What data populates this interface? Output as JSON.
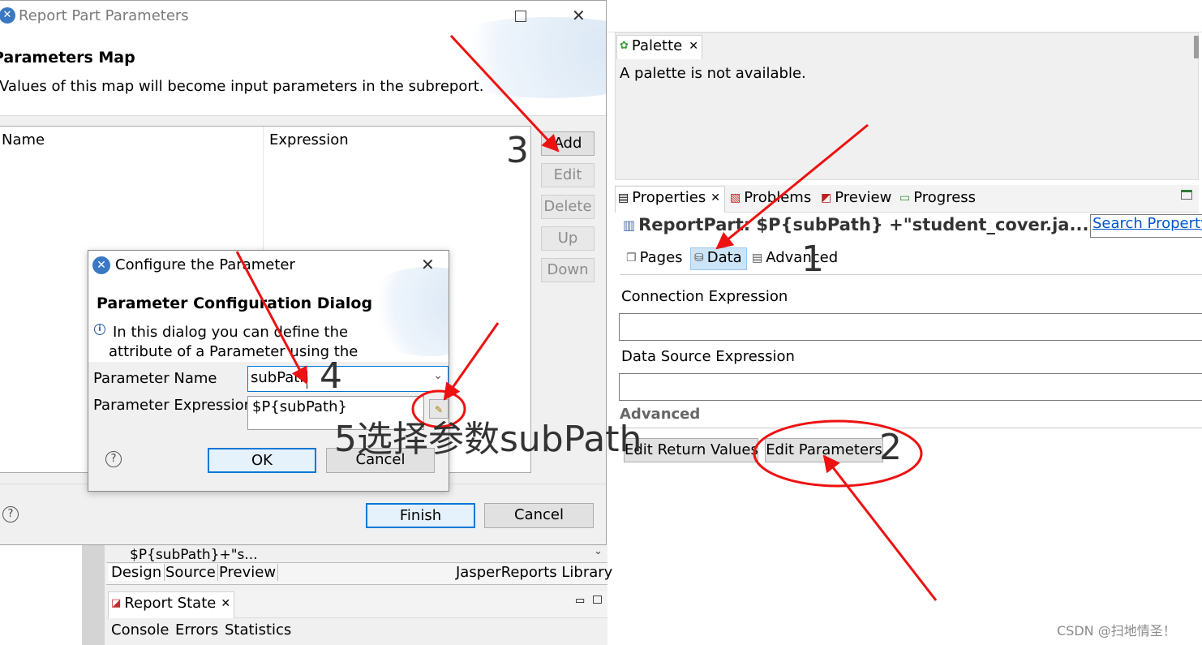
{
  "colors": {
    "accent": "#0078d7",
    "annotation": "#ee1111",
    "panel_gray": "#f0f0f0",
    "sidebar_gray": "#d4d4d4"
  },
  "main_dialog": {
    "title": "Report Part Parameters",
    "heading": "Parameters Map",
    "description": "Values of this map will become input parameters in the subreport.",
    "columns": [
      "Name",
      "Expression"
    ],
    "buttons": {
      "add": "Add",
      "edit": "Edit",
      "delete": "Delete",
      "up": "Up",
      "down": "Down",
      "finish": "Finish",
      "cancel": "Cancel"
    },
    "help_icon": "?"
  },
  "param_dialog": {
    "title": "Configure the Parameter",
    "heading": "Parameter Configuration Dialog",
    "info_line1": "In this dialog you can define the",
    "info_line2": "attribute of a Parameter using the",
    "name_label": "Parameter Name",
    "name_value": "subPath",
    "expression_label": "Parameter Expression",
    "expression_value": "$P{subPath}",
    "ok": "OK",
    "cancel": "Cancel",
    "help_icon": "?"
  },
  "bottom_editor": {
    "expression_snippet": "$P{subPath}+\"s...",
    "tabs": [
      "Design",
      "Source",
      "Preview"
    ],
    "library_label": "JasperReports Library",
    "report_state_tab": "Report State",
    "console_tabs": [
      "Console",
      "Errors",
      "Statistics"
    ]
  },
  "palette": {
    "tab_label": "Palette",
    "message": "A palette is not available."
  },
  "properties": {
    "tabs": [
      "Properties",
      "Problems",
      "Preview",
      "Progress"
    ],
    "title": "ReportPart: $P{subPath} +\"student_cover.ja...",
    "search_label": "Search Property",
    "subtabs": [
      "Pages",
      "Data",
      "Advanced"
    ],
    "connection_label": "Connection Expression",
    "datasource_label": "Data Source Expression",
    "advanced_label": "Advanced",
    "edit_return_values": "Edit Return Values",
    "edit_parameters": "Edit Parameters"
  },
  "annotations": {
    "step1": "1",
    "step2": "2",
    "step3": "3",
    "step4": "4",
    "step5": "5选择参数subPath"
  },
  "watermark": "CSDN @扫地情圣！",
  "icons": [
    "app-icon",
    "maximize-icon",
    "close-icon",
    "palette-icon",
    "properties-icon",
    "problems-icon",
    "preview-icon",
    "progress-icon",
    "report-part-icon",
    "pages-icon",
    "database-icon",
    "advanced-icon",
    "info-icon",
    "chevron-down-icon",
    "expression-editor-icon",
    "help-icon",
    "report-state-icon",
    "minimize-icon"
  ]
}
